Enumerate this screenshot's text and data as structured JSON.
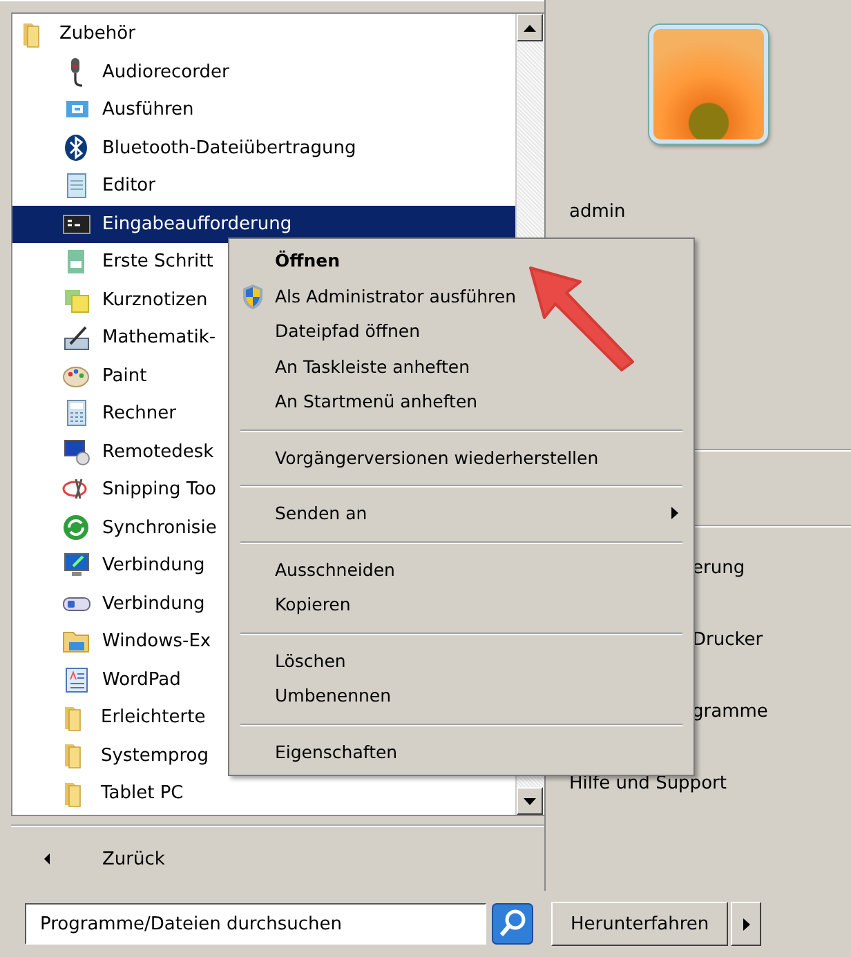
{
  "programs": {
    "items": [
      {
        "label": "Zubehör",
        "kind": "folder",
        "selected": false,
        "children": [
          {
            "label": "Audiorecorder",
            "kind": "app",
            "selected": false
          },
          {
            "label": "Ausführen",
            "kind": "app",
            "selected": false
          },
          {
            "label": "Bluetooth-Dateiübertragung",
            "kind": "app",
            "selected": false
          },
          {
            "label": "Editor",
            "kind": "app",
            "selected": false
          },
          {
            "label": "Eingabeaufforderung",
            "kind": "app",
            "selected": true
          },
          {
            "label": "Erste Schritt",
            "kind": "app",
            "selected": false
          },
          {
            "label": "Kurznotizen",
            "kind": "app",
            "selected": false
          },
          {
            "label": "Mathematik-",
            "kind": "app",
            "selected": false
          },
          {
            "label": "Paint",
            "kind": "app",
            "selected": false
          },
          {
            "label": "Rechner",
            "kind": "app",
            "selected": false
          },
          {
            "label": "Remotedesk",
            "kind": "app",
            "selected": false
          },
          {
            "label": "Snipping Too",
            "kind": "app",
            "selected": false
          },
          {
            "label": "Synchronisie",
            "kind": "app",
            "selected": false
          },
          {
            "label": "Verbindung",
            "kind": "app",
            "selected": false
          },
          {
            "label": "Verbindung",
            "kind": "app",
            "selected": false
          },
          {
            "label": "Windows-Ex",
            "kind": "app",
            "selected": false
          },
          {
            "label": "WordPad",
            "kind": "app",
            "selected": false
          },
          {
            "label": "Erleichterte",
            "kind": "folder",
            "selected": false
          },
          {
            "label": "Systemprog",
            "kind": "folder",
            "selected": false
          },
          {
            "label": "Tablet PC",
            "kind": "folder",
            "selected": false
          }
        ]
      }
    ]
  },
  "back_button": {
    "label": "Zurück"
  },
  "search": {
    "placeholder": "Programme/Dateien durchsuchen"
  },
  "context_menu": {
    "items": [
      {
        "label": "Öffnen",
        "kind": "default"
      },
      {
        "label": "Als Administrator ausführen",
        "kind": "shield"
      },
      {
        "label": "Dateipfad öffnen",
        "kind": "plain"
      },
      {
        "label": "An Taskleiste anheften",
        "kind": "plain"
      },
      {
        "label": "An Startmenü anheften",
        "kind": "plain"
      },
      {
        "kind": "separator"
      },
      {
        "label": "Vorgängerversionen wiederherstellen",
        "kind": "plain"
      },
      {
        "kind": "separator"
      },
      {
        "label": "Senden an",
        "kind": "submenu"
      },
      {
        "kind": "separator"
      },
      {
        "label": "Ausschneiden",
        "kind": "plain"
      },
      {
        "label": "Kopieren",
        "kind": "plain"
      },
      {
        "kind": "separator"
      },
      {
        "label": "Löschen",
        "kind": "plain"
      },
      {
        "label": "Umbenennen",
        "kind": "plain"
      },
      {
        "kind": "separator"
      },
      {
        "label": "Eigenschaften",
        "kind": "plain"
      }
    ]
  },
  "user": {
    "name": "admin"
  },
  "right_links": [
    {
      "label": "erung",
      "covered": true
    },
    {
      "label": "Drucker",
      "covered": true
    },
    {
      "label": "gramme",
      "covered": true
    },
    {
      "label": "Hilfe und Support",
      "covered": false
    }
  ],
  "shutdown": {
    "label": "Herunterfahren"
  }
}
